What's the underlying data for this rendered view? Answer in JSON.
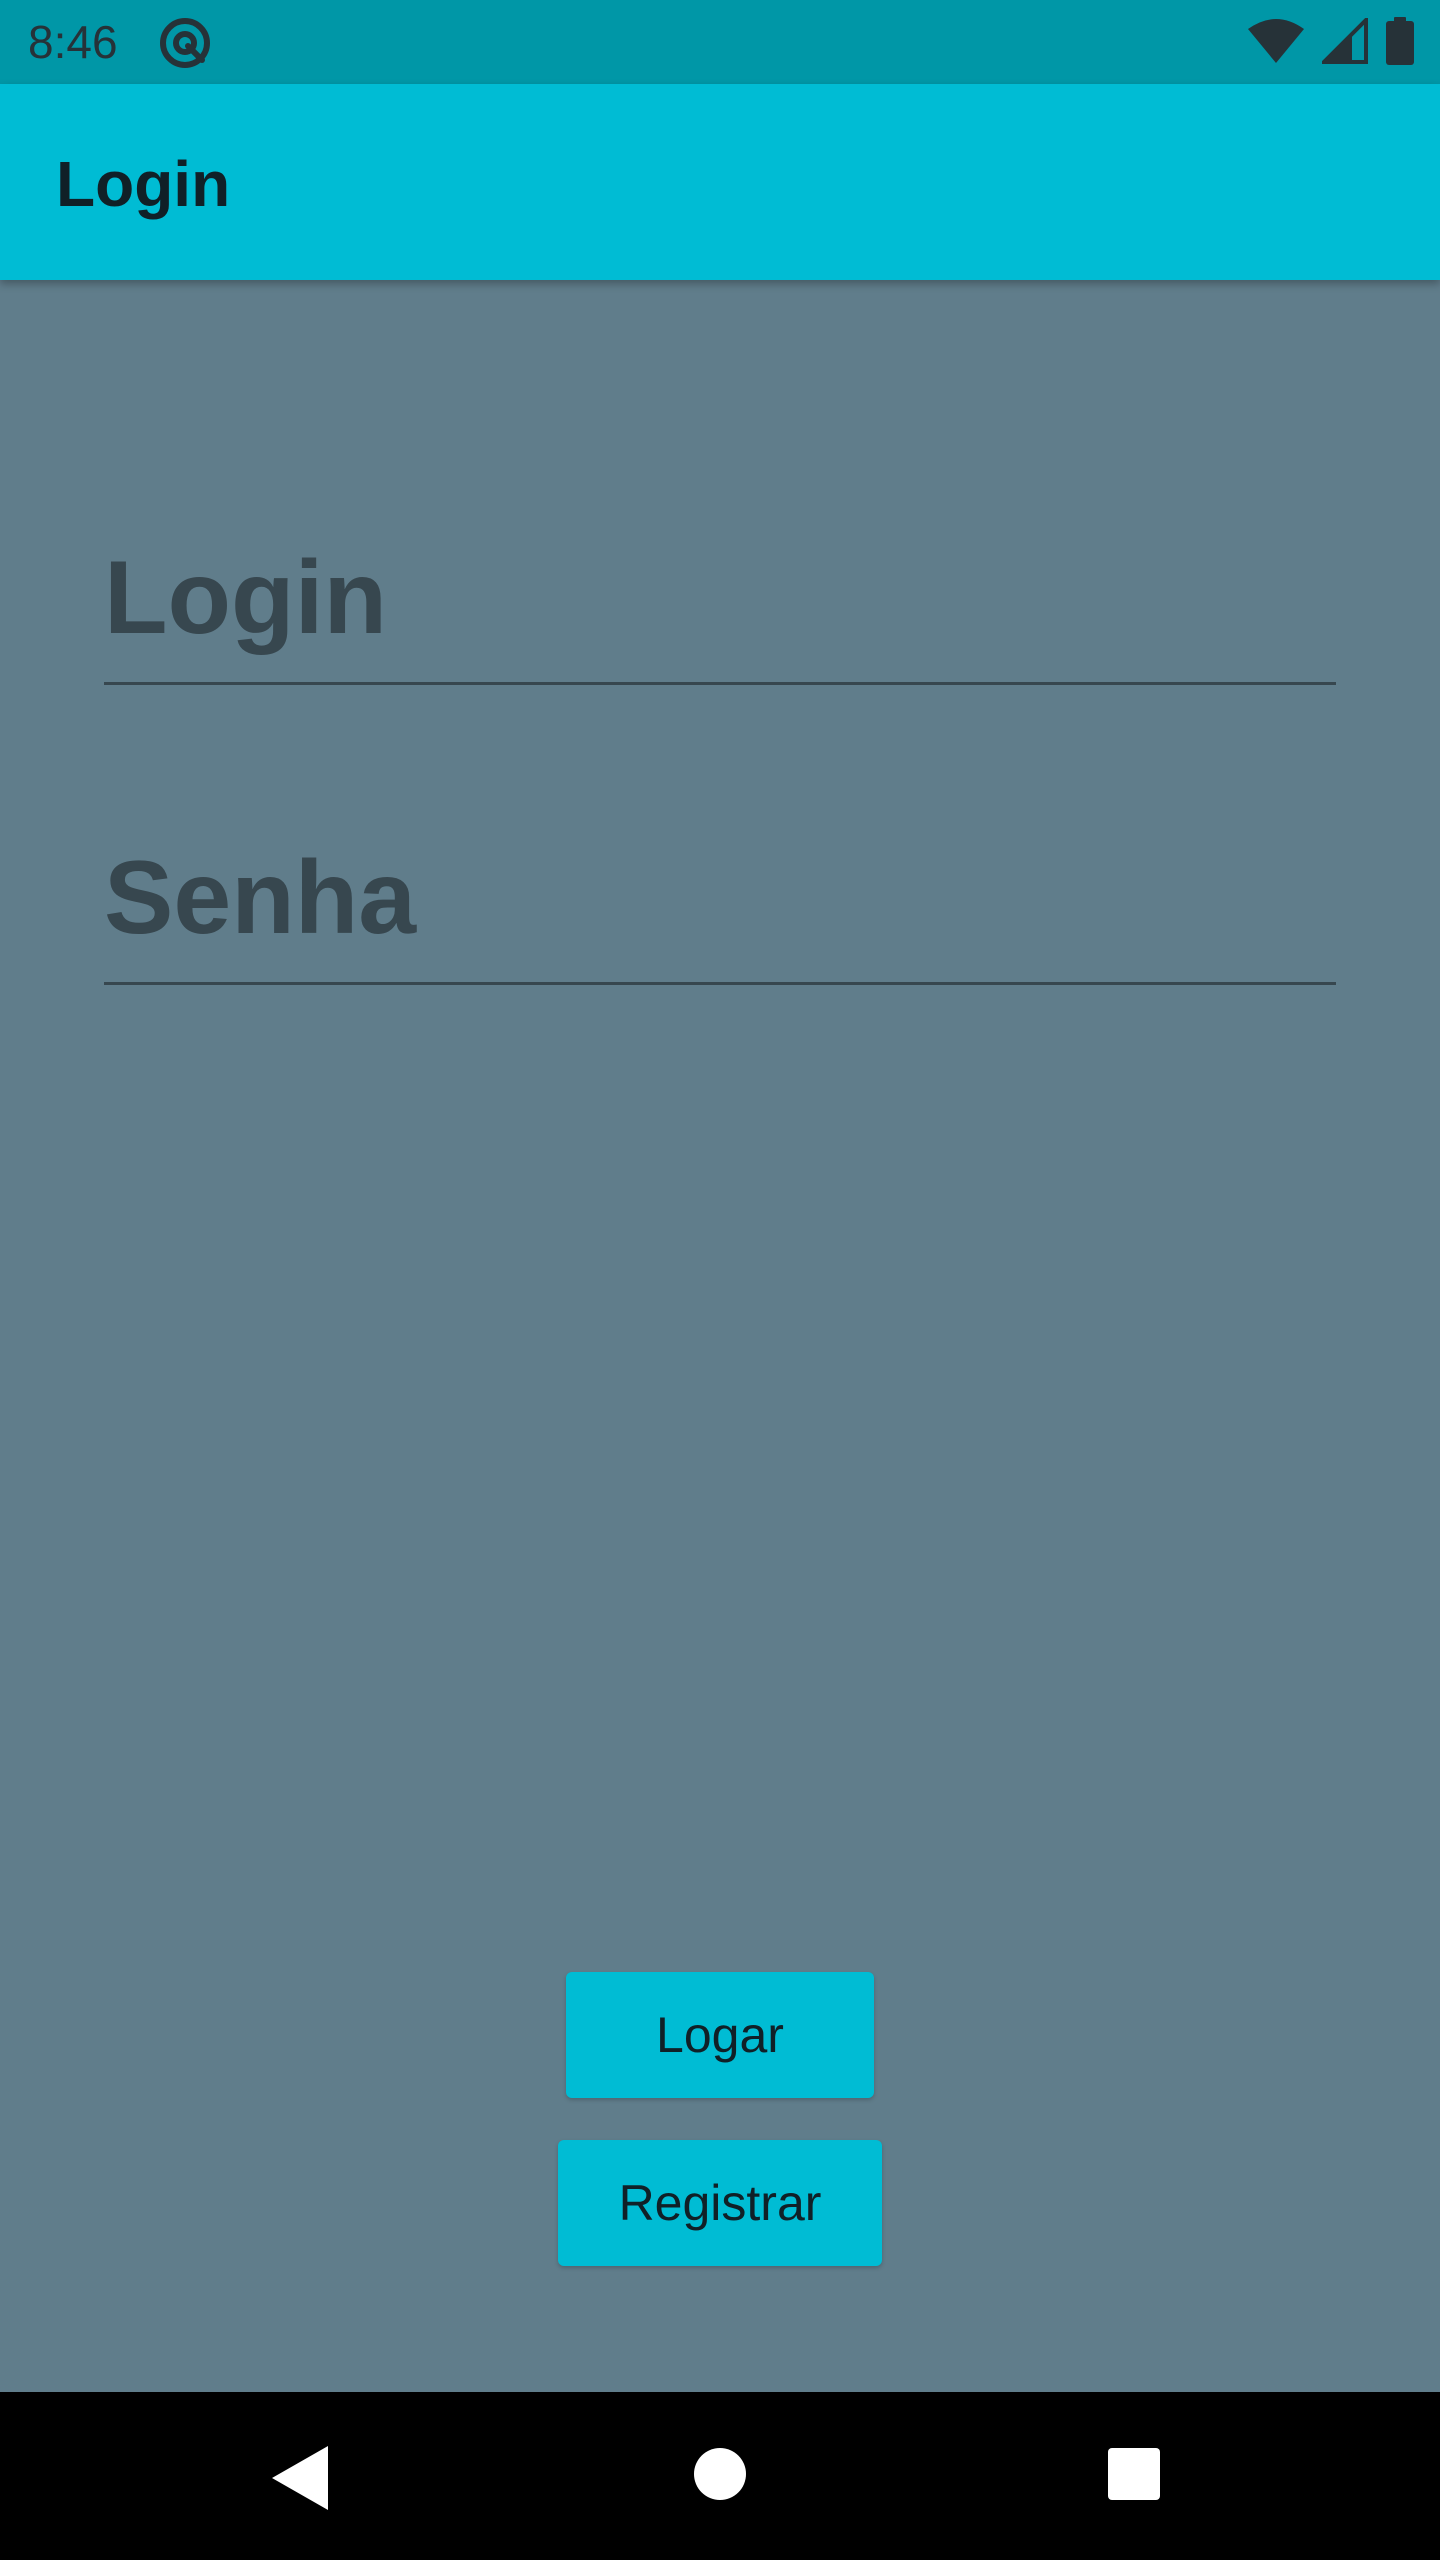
{
  "status_bar": {
    "time": "8:46",
    "icons": [
      "notification-icon",
      "wifi-icon",
      "cell-signal-icon",
      "battery-icon"
    ]
  },
  "app_bar": {
    "title": "Login"
  },
  "form": {
    "login_placeholder": "Login",
    "login_value": "",
    "password_placeholder": "Senha",
    "password_value": ""
  },
  "buttons": {
    "logar_label": "Logar",
    "registrar_label": "Registrar"
  },
  "nav_bar": {
    "icons": [
      "back-icon",
      "home-icon",
      "recents-icon"
    ]
  },
  "colors": {
    "status_bar": "#0097a7",
    "app_bar": "#00bcd4",
    "background": "#607d8b",
    "accent_button": "#00bcd4",
    "text_dark": "#37474f"
  }
}
